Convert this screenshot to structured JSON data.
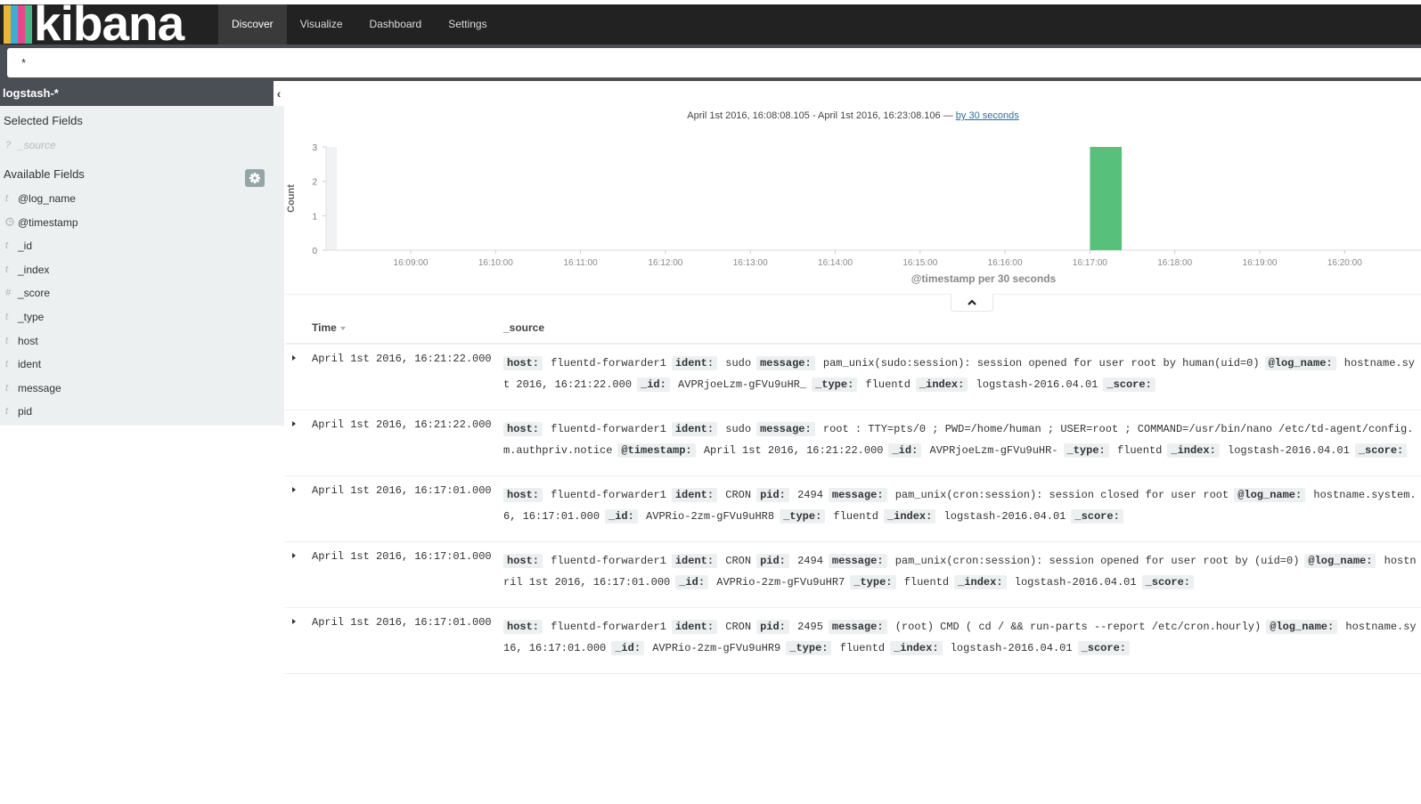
{
  "app": {
    "logo_text": "kibana",
    "logo_colors": [
      "#e8b630",
      "#3caed8",
      "#e8488b",
      "#45b987"
    ]
  },
  "nav": {
    "items": [
      {
        "label": "Discover",
        "active": true
      },
      {
        "label": "Visualize",
        "active": false
      },
      {
        "label": "Dashboard",
        "active": false
      },
      {
        "label": "Settings",
        "active": false
      }
    ]
  },
  "query": {
    "value": "*"
  },
  "sidebar": {
    "index_pattern": "logstash-*",
    "selected_heading": "Selected Fields",
    "selected_fields": [
      {
        "type": "?",
        "name": "_source"
      }
    ],
    "available_heading": "Available Fields",
    "available_fields": [
      {
        "type": "t",
        "name": "@log_name"
      },
      {
        "type": "clock",
        "name": "@timestamp"
      },
      {
        "type": "t",
        "name": "_id"
      },
      {
        "type": "t",
        "name": "_index"
      },
      {
        "type": "#",
        "name": "_score"
      },
      {
        "type": "t",
        "name": "_type"
      },
      {
        "type": "t",
        "name": "host"
      },
      {
        "type": "t",
        "name": "ident"
      },
      {
        "type": "t",
        "name": "message"
      },
      {
        "type": "t",
        "name": "pid"
      }
    ]
  },
  "histogram": {
    "range_text": "April 1st 2016, 16:08:08.105 - April 1st 2016, 16:23:08.106 —",
    "interval_link": "by 30 seconds",
    "bar_color": "#57c17b"
  },
  "chart_data": {
    "type": "bar",
    "ylabel": "Count",
    "xlabel": "@timestamp per 30 seconds",
    "ylim": [
      0,
      3
    ],
    "yticks": [
      0,
      1,
      2,
      3
    ],
    "xticks": [
      "16:09:00",
      "16:10:00",
      "16:11:00",
      "16:12:00",
      "16:13:00",
      "16:14:00",
      "16:15:00",
      "16:16:00",
      "16:17:00",
      "16:18:00",
      "16:19:00",
      "16:20:00"
    ],
    "x": [
      "16:17:00"
    ],
    "values": [
      3
    ]
  },
  "table": {
    "time_header": "Time",
    "source_header": "_source",
    "rows": [
      {
        "time": "April 1st 2016, 16:21:22.000",
        "lines": [
          [
            [
              "host:",
              "fluentd-forwarder1"
            ],
            [
              "ident:",
              "sudo"
            ],
            [
              "message:",
              "pam_unix(sudo:session): session opened for user root by human(uid=0)"
            ],
            [
              "@log_name:",
              "hostname.sy"
            ]
          ],
          [
            [
              "",
              "t 2016, 16:21:22.000"
            ],
            [
              "_id:",
              "AVPRjoeLzm-gFVu9uHR_"
            ],
            [
              "_type:",
              "fluentd"
            ],
            [
              "_index:",
              "logstash-2016.04.01"
            ],
            [
              "_score:",
              ""
            ]
          ]
        ]
      },
      {
        "time": "April 1st 2016, 16:21:22.000",
        "lines": [
          [
            [
              "host:",
              "fluentd-forwarder1"
            ],
            [
              "ident:",
              "sudo"
            ],
            [
              "message:",
              "root : TTY=pts/0 ; PWD=/home/human ; USER=root ; COMMAND=/usr/bin/nano /etc/td-agent/config."
            ]
          ],
          [
            [
              "",
              "m.authpriv.notice"
            ],
            [
              "@timestamp:",
              "April 1st 2016, 16:21:22.000"
            ],
            [
              "_id:",
              "AVPRjoeLzm-gFVu9uHR-"
            ],
            [
              "_type:",
              "fluentd"
            ],
            [
              "_index:",
              "logstash-2016.04.01"
            ],
            [
              "_score:",
              ""
            ]
          ]
        ]
      },
      {
        "time": "April 1st 2016, 16:17:01.000",
        "lines": [
          [
            [
              "host:",
              "fluentd-forwarder1"
            ],
            [
              "ident:",
              "CRON"
            ],
            [
              "pid:",
              "2494"
            ],
            [
              "message:",
              "pam_unix(cron:session): session closed for user root"
            ],
            [
              "@log_name:",
              "hostname.system."
            ]
          ],
          [
            [
              "",
              "6, 16:17:01.000"
            ],
            [
              "_id:",
              "AVPRio-2zm-gFVu9uHR8"
            ],
            [
              "_type:",
              "fluentd"
            ],
            [
              "_index:",
              "logstash-2016.04.01"
            ],
            [
              "_score:",
              ""
            ]
          ]
        ]
      },
      {
        "time": "April 1st 2016, 16:17:01.000",
        "lines": [
          [
            [
              "host:",
              "fluentd-forwarder1"
            ],
            [
              "ident:",
              "CRON"
            ],
            [
              "pid:",
              "2494"
            ],
            [
              "message:",
              "pam_unix(cron:session): session opened for user root by (uid=0)"
            ],
            [
              "@log_name:",
              "hostn"
            ]
          ],
          [
            [
              "",
              "ril 1st 2016, 16:17:01.000"
            ],
            [
              "_id:",
              "AVPRio-2zm-gFVu9uHR7"
            ],
            [
              "_type:",
              "fluentd"
            ],
            [
              "_index:",
              "logstash-2016.04.01"
            ],
            [
              "_score:",
              ""
            ]
          ]
        ]
      },
      {
        "time": "April 1st 2016, 16:17:01.000",
        "lines": [
          [
            [
              "host:",
              "fluentd-forwarder1"
            ],
            [
              "ident:",
              "CRON"
            ],
            [
              "pid:",
              "2495"
            ],
            [
              "message:",
              "(root) CMD ( cd / && run-parts --report /etc/cron.hourly)"
            ],
            [
              "@log_name:",
              "hostname.sy"
            ]
          ],
          [
            [
              "",
              "16, 16:17:01.000"
            ],
            [
              "_id:",
              "AVPRio-2zm-gFVu9uHR9"
            ],
            [
              "_type:",
              "fluentd"
            ],
            [
              "_index:",
              "logstash-2016.04.01"
            ],
            [
              "_score:",
              ""
            ]
          ]
        ]
      }
    ]
  }
}
